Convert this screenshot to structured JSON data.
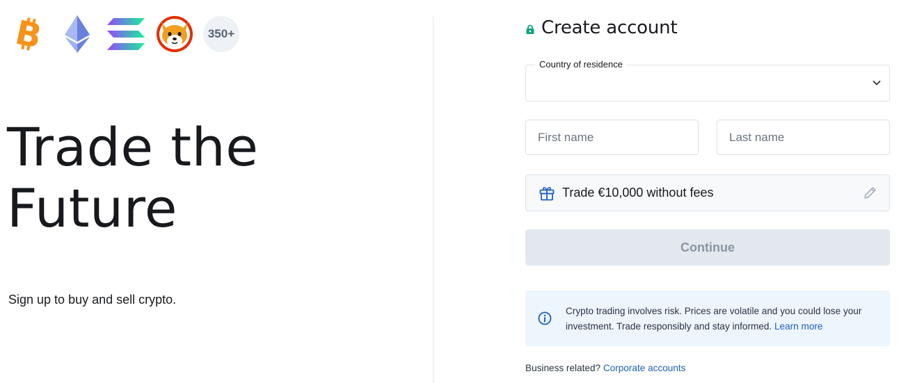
{
  "coins": [
    {
      "name": "bitcoin-icon",
      "color": "#f7931a"
    },
    {
      "name": "ethereum-icon",
      "color": "#627eea"
    },
    {
      "name": "solana-icon",
      "color": "#14f195"
    },
    {
      "name": "shiba-inu-icon",
      "color": "#e42d04"
    }
  ],
  "coins_more_label": "350+",
  "hero": {
    "title_line1": "Trade the",
    "title_line2": "Future",
    "subtitle": "Sign up to buy and sell crypto."
  },
  "form": {
    "title": "Create account",
    "country_label": "Country of residence",
    "country_value": "",
    "first_name_placeholder": "First name",
    "last_name_placeholder": "Last name",
    "promo_text": "Trade €10,000 without fees",
    "continue_label": "Continue"
  },
  "notice": {
    "text": "Crypto trading involves risk. Prices are volatile and you could lose your investment. Trade responsibly and stay informed. ",
    "link_label": "Learn more"
  },
  "footer": {
    "business_text": "Business related? ",
    "business_link": "Corporate accounts"
  },
  "colors": {
    "accent_green": "#10a37f",
    "link_blue": "#1f5fbf",
    "notice_bg": "#edf5fd",
    "button_disabled_bg": "#e3e8ee"
  }
}
